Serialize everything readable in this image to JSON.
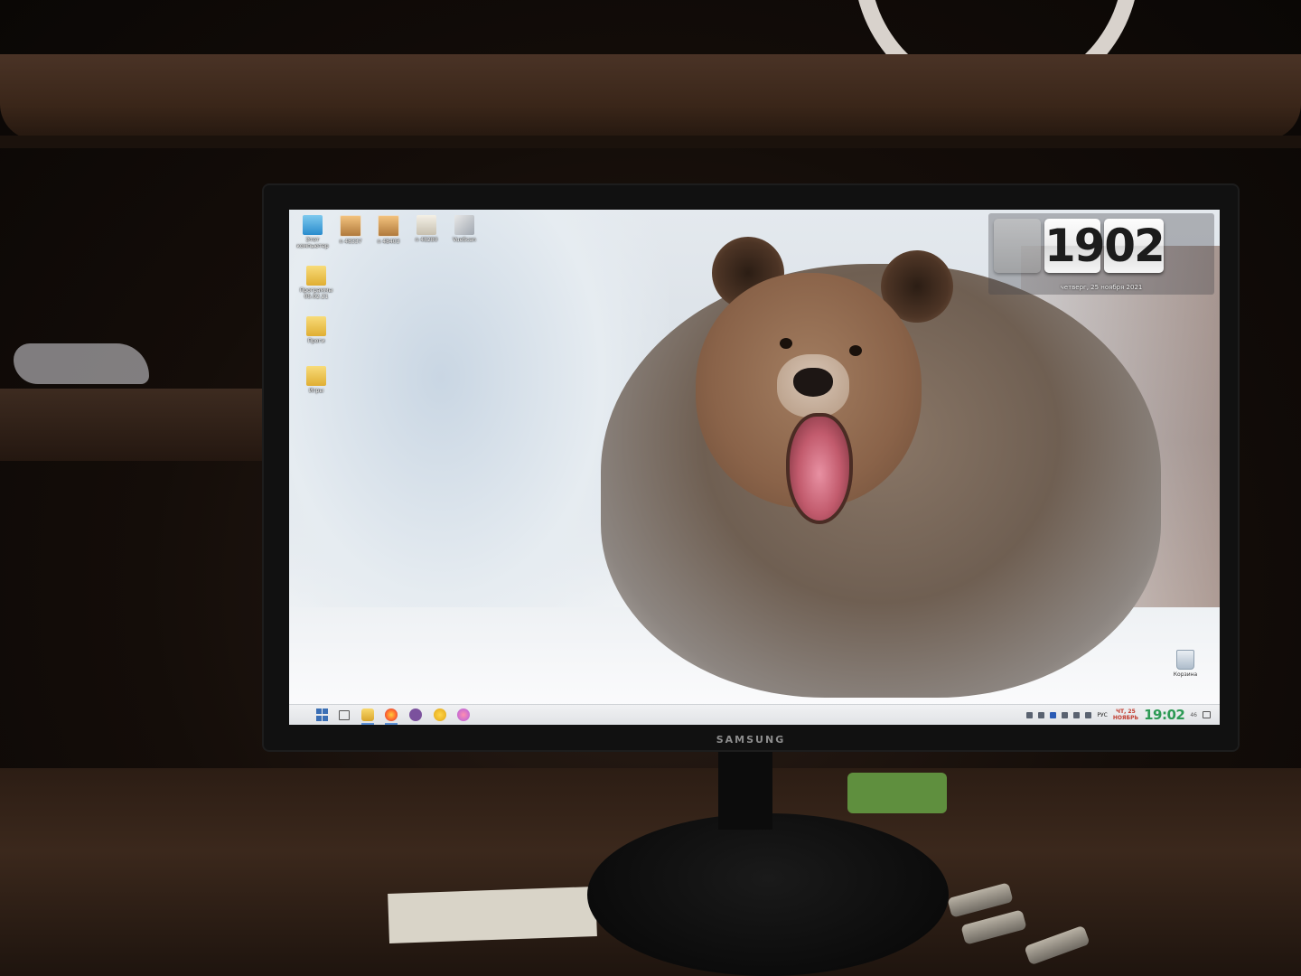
{
  "monitor": {
    "brand": "SAMSUNG"
  },
  "desktop": {
    "icons": [
      {
        "label": "Этот компьютер",
        "icon": "computer-icon"
      },
      {
        "label": "n 48337",
        "icon": "image-file-icon"
      },
      {
        "label": "n 48403",
        "icon": "image-file-icon"
      },
      {
        "label": "n 48280",
        "icon": "document-icon"
      },
      {
        "label": "VueScan",
        "icon": "scanner-app-icon"
      },
      {
        "label": "Программы 05.02.21",
        "icon": "folder-icon"
      },
      {
        "label": "Проги",
        "icon": "folder-icon"
      },
      {
        "label": "Игры",
        "icon": "folder-icon"
      }
    ],
    "recycle_bin": {
      "label": "Корзина",
      "icon": "recycle-bin-icon"
    }
  },
  "clock_widget": {
    "hours": "19",
    "minutes": "02",
    "date": "четверг, 25 ноября 2021"
  },
  "taskbar": {
    "apps": [
      "start-icon",
      "task-view-icon",
      "file-explorer-icon",
      "firefox-icon",
      "viber-icon",
      "weather-icon",
      "paint-app-icon"
    ],
    "tray": {
      "language": "РУС",
      "day": "ЧТ, 25",
      "month": "НОЯБРЬ",
      "time": "19:02",
      "seconds": "46"
    }
  },
  "colors": {
    "taskbar_time": "#2d9a55",
    "taskbar_date": "#c23b2e",
    "accent": "#5b8fd6"
  }
}
